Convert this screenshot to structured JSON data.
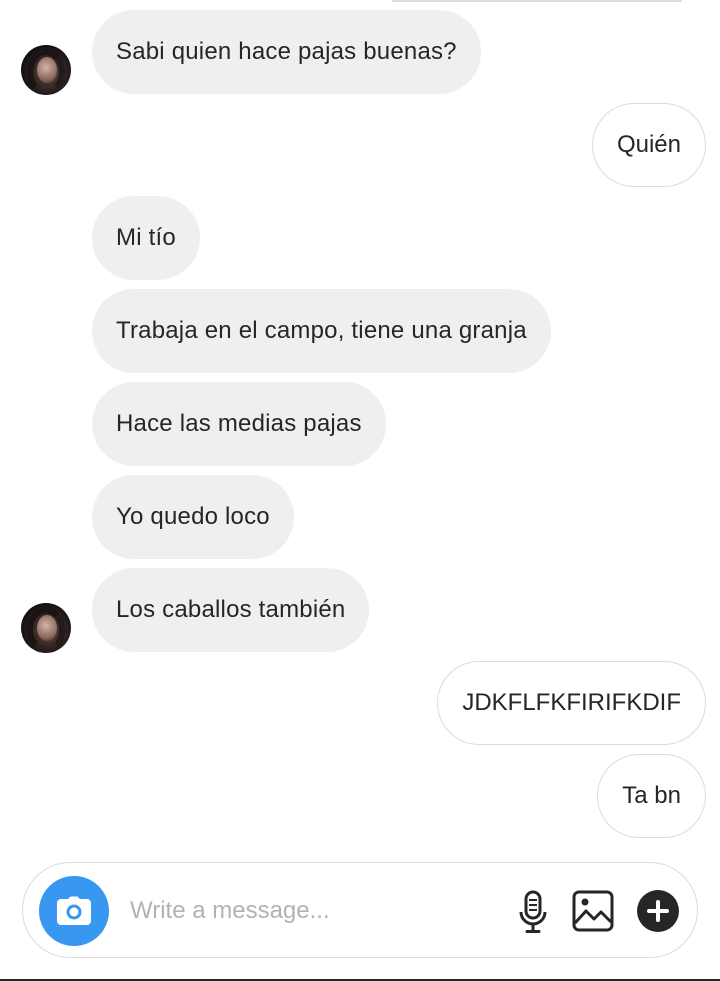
{
  "conversation": {
    "messages": [
      {
        "direction": "in",
        "text": "Sabi quien hace pajas buenas?"
      },
      {
        "direction": "out",
        "text": "Quién"
      },
      {
        "direction": "in",
        "text": "Mi tío"
      },
      {
        "direction": "in",
        "text": "Trabaja en el campo, tiene una granja"
      },
      {
        "direction": "in",
        "text": "Hace las medias pajas"
      },
      {
        "direction": "in",
        "text": "Yo quedo loco"
      },
      {
        "direction": "in",
        "text": "Los caballos también"
      },
      {
        "direction": "out",
        "text": "JDKFLFKFIRIFKDIF"
      },
      {
        "direction": "out",
        "text": "Ta bn"
      }
    ]
  },
  "composer": {
    "placeholder": "Write a message...",
    "value": "",
    "icons": {
      "camera": "camera-icon",
      "mic": "microphone-icon",
      "gallery": "gallery-icon",
      "more": "plus-icon"
    }
  },
  "colors": {
    "incoming_bubble": "#efefef",
    "outgoing_border": "#dbdbdb",
    "camera_button": "#3897f0",
    "text": "#262626",
    "placeholder": "#b2b2b2"
  }
}
